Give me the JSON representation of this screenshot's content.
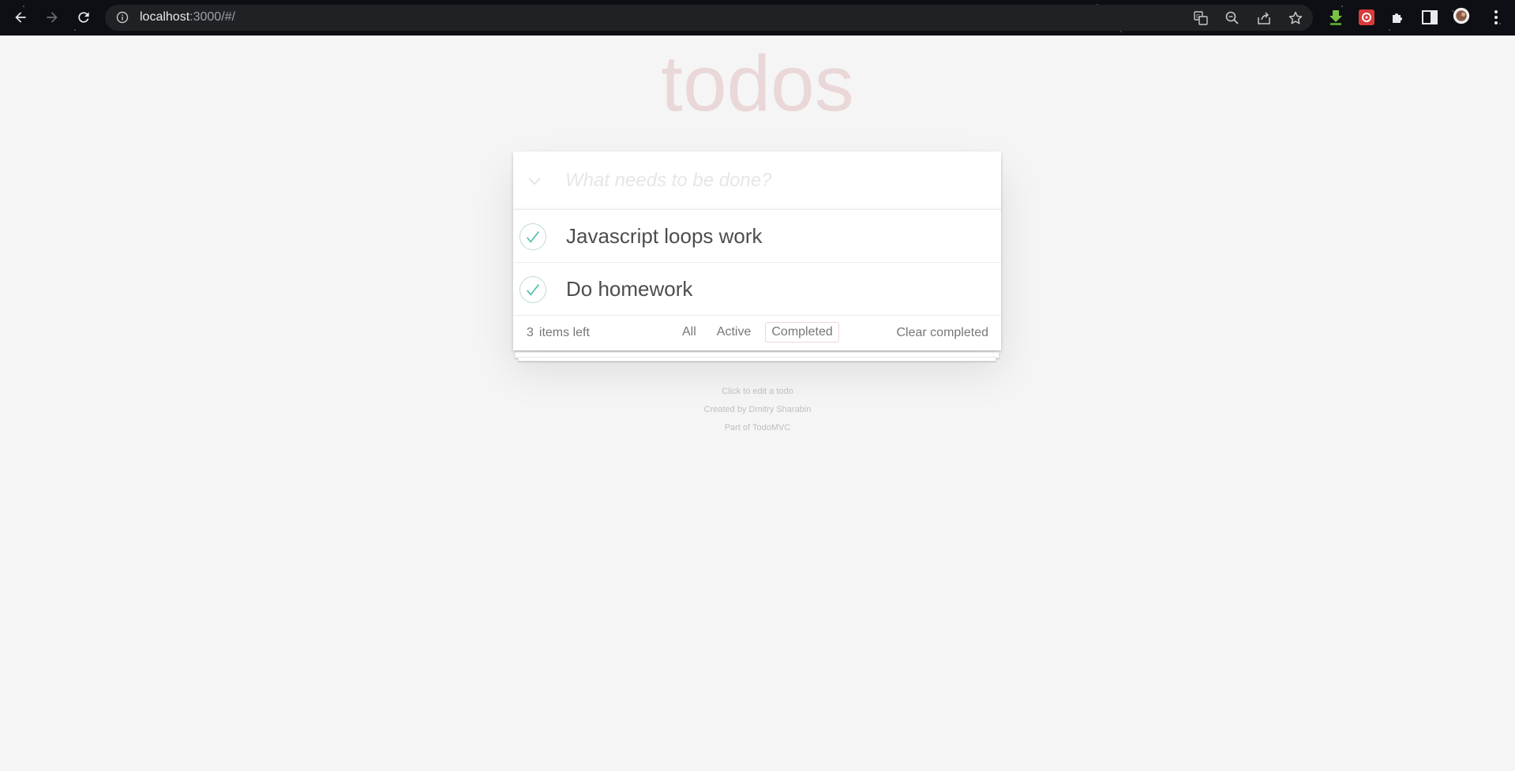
{
  "browser": {
    "url_host": "localhost",
    "url_rest": ":3000/#/",
    "icons": [
      "back-icon",
      "forward-icon",
      "reload-icon",
      "info-icon",
      "translate-icon",
      "zoom-icon",
      "share-icon",
      "star-icon",
      "download-extension-icon",
      "extension-red-icon",
      "puzzle-icon",
      "side-panel-icon",
      "avatar",
      "menu-icon"
    ]
  },
  "app": {
    "title": "todos",
    "new_todo_placeholder": "What needs to be done?",
    "todos": [
      {
        "label": "Javascript loops work",
        "completed": true
      },
      {
        "label": "Do homework",
        "completed": true
      }
    ],
    "footer": {
      "count": "3",
      "count_label": "items left",
      "filters": [
        "All",
        "Active",
        "Completed"
      ],
      "selected_filter": "Completed",
      "clear_label": "Clear completed"
    }
  },
  "info": {
    "line1": "Click to edit a todo",
    "line2": "Created by Dmitry Sharabin",
    "line3": "Part of TodoMVC"
  },
  "colors": {
    "title": "#af2f2f",
    "check": "#5dc2af",
    "background": "#f5f5f5"
  }
}
